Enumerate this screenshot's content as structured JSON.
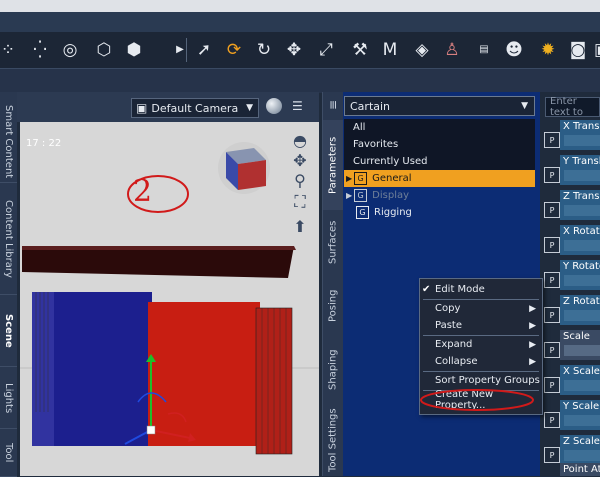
{
  "toolbar": {
    "icons": [
      "node-icon",
      "transform-dot-icon",
      "universal-icon",
      "geometry-icon",
      "camera-rig-icon",
      "play-icon",
      "pointer-icon",
      "rotate-active-icon",
      "rotate-icon",
      "translate-icon",
      "scale-icon",
      "joint-icon",
      "morph-icon",
      "surface-icon",
      "figure-icon",
      "text-icon",
      "user-icon",
      "light-icon",
      "render-icon",
      "render-settings-icon"
    ]
  },
  "left_tabs": [
    "Smart Content",
    "Content Library",
    "Scene",
    "Lights",
    "Tool"
  ],
  "viewport": {
    "camera": "Default Camera",
    "frame_counter": "17 : 22",
    "annotation": "2"
  },
  "param_tabs": [
    "Parameters",
    "Surfaces",
    "Posing",
    "Shaping",
    "Tool Settings"
  ],
  "panel": {
    "node": "Cartain",
    "filter_placeholder": "Enter text to",
    "groups": [
      {
        "label": "All",
        "selected": false,
        "icon": false
      },
      {
        "label": "Favorites",
        "selected": false,
        "icon": false
      },
      {
        "label": "Currently Used",
        "selected": false,
        "icon": false
      },
      {
        "label": "General",
        "selected": true,
        "icon": true
      },
      {
        "label": "Display",
        "selected": false,
        "icon": true,
        "dimmed": true
      },
      {
        "label": "Rigging",
        "selected": false,
        "icon": true
      }
    ]
  },
  "properties": [
    "X Translate",
    "Y Translate",
    "Z Translate",
    "X Rotate",
    "Y Rotate",
    "Z Rotate",
    "Scale",
    "X Scale",
    "Y Scale",
    "Z Scale",
    "Point At"
  ],
  "context_menu": {
    "items": [
      "Edit Mode",
      "Copy",
      "Paste",
      "Expand",
      "Collapse",
      "Sort Property Groups",
      "Create New Property..."
    ],
    "edit_mode_checked": true
  },
  "colors": {
    "selected_group": "#f0a020",
    "annotation": "#d11a1a",
    "panel_bg": "#0c2c74",
    "red_curtain": "#c81e12",
    "blue_curtain": "#1c1f8e"
  }
}
